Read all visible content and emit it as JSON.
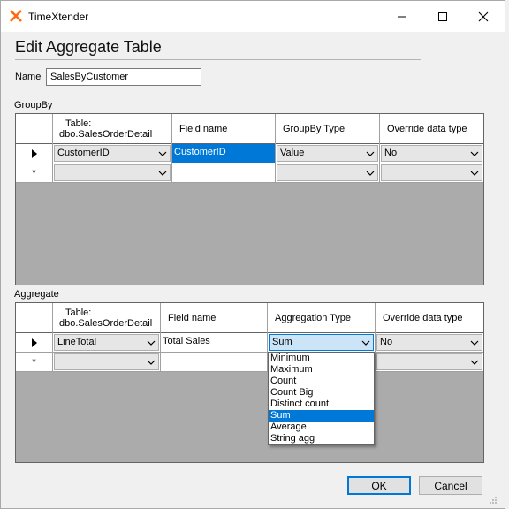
{
  "window": {
    "title": "TimeXtender"
  },
  "dialog": {
    "heading": "Edit Aggregate Table",
    "name_label": "Name",
    "name_value": "SalesByCustomer"
  },
  "groupby": {
    "section_label": "GroupBy",
    "headers": [
      "Table:",
      "dbo.SalesOrderDetail",
      "Field name",
      "GroupBy Type",
      "Override data type"
    ],
    "row1": {
      "table": "CustomerID",
      "field": "CustomerID",
      "type": "Value",
      "override": "No"
    },
    "row2": {
      "marker": "*"
    }
  },
  "aggregate": {
    "section_label": "Aggregate",
    "headers": [
      "Table:",
      "dbo.SalesOrderDetail",
      "Field name",
      "Aggregation Type",
      "Override data type"
    ],
    "row1": {
      "table": "LineTotal",
      "field": "Total Sales",
      "type": "Sum",
      "override": "No"
    },
    "row2": {
      "marker": "*"
    }
  },
  "dropdown": {
    "options": [
      "Minimum",
      "Maximum",
      "Count",
      "Count Big",
      "Distinct count",
      "Sum",
      "Average",
      "String agg"
    ],
    "selected": "Sum"
  },
  "buttons": {
    "ok": "OK",
    "cancel": "Cancel"
  },
  "colors": {
    "accent": "#0078d7",
    "brand": "#ff6a13",
    "grid_bg": "#ababab"
  }
}
